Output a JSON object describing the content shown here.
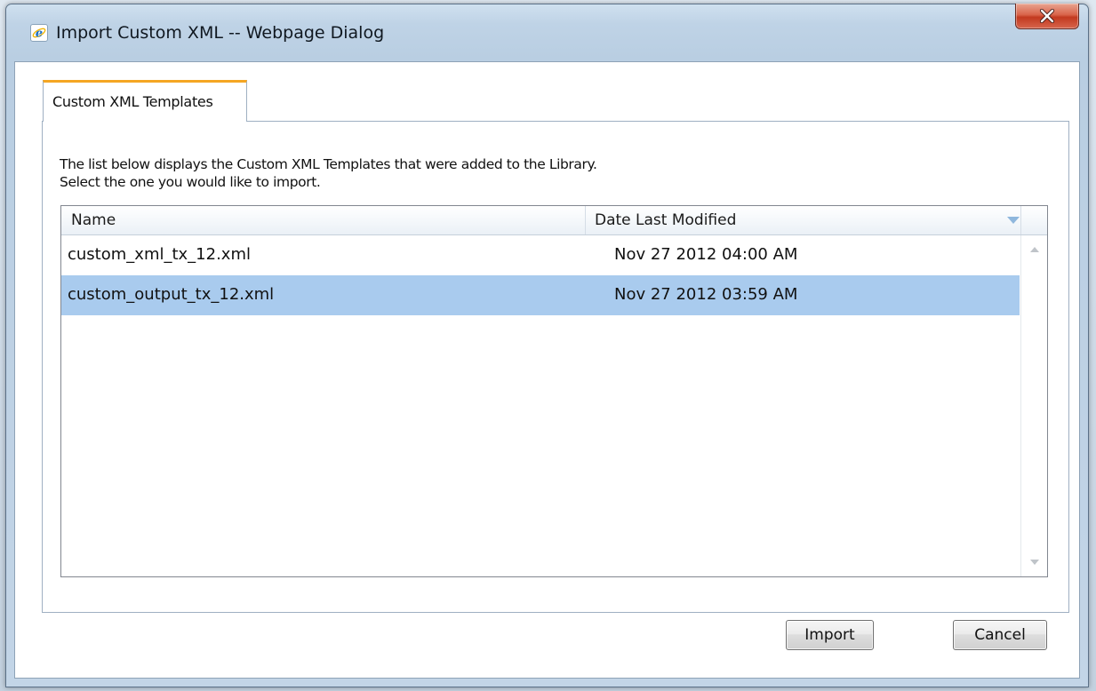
{
  "window": {
    "title": "Import Custom XML -- Webpage Dialog",
    "close_symbol": "X"
  },
  "tabs": [
    {
      "label": "Custom XML Templates",
      "active": true
    }
  ],
  "description": {
    "line1": "The list below displays the Custom XML Templates that were added to the Library.",
    "line2": "Select the one you would like to import."
  },
  "grid": {
    "columns": [
      {
        "label": "Name"
      },
      {
        "label": "Date Last Modified",
        "sorted": "descending"
      }
    ],
    "rows": [
      {
        "name": "custom_xml_tx_12.xml",
        "date": "Nov 27 2012 04:00 AM",
        "selected": false
      },
      {
        "name": "custom_output_tx_12.xml",
        "date": "Nov 27 2012 03:59 AM",
        "selected": true
      }
    ]
  },
  "buttons": {
    "import_label": "Import",
    "cancel_label": "Cancel"
  },
  "icons": {
    "app": "internet-explorer-icon",
    "close": "close-icon",
    "sort": "sort-descending-icon",
    "scroll_up": "scroll-up-arrow-icon",
    "scroll_down": "scroll-down-arrow-icon"
  },
  "colors": {
    "selection": "#a9cbee",
    "tab_accent": "#f5a623",
    "close_button": "#c2391f"
  }
}
